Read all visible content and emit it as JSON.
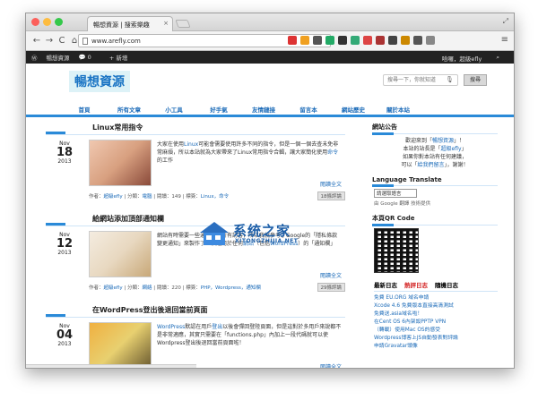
{
  "browser": {
    "tab_title": "暢想資源 | 搜索樂趣",
    "tab_close": "×",
    "url": "www.arefly.com",
    "nav": {
      "back": "←",
      "forward": "→",
      "reload": "C",
      "home": "⌂"
    },
    "star": "☆",
    "menu": "≡",
    "fullscreen": "⤢",
    "extension_colors": [
      "#d33",
      "#f0a020",
      "#555",
      "#2a6",
      "#333",
      "#3a7",
      "#d44",
      "#a33",
      "#444",
      "#c80",
      "#555",
      "#888"
    ]
  },
  "wpbar": {
    "site_name": "暢想資源",
    "comments": "0",
    "new": "+ 新增",
    "greeting": "哈囉，超級efly"
  },
  "site": {
    "logo": "暢想資源",
    "search_placeholder": "搜尋一下，你就知道",
    "search_button": "搜尋",
    "nav": [
      "首頁",
      "所有文章",
      "小工具",
      "好手氣",
      "友情鏈接",
      "留言本",
      "網站歷史",
      "關於本站"
    ]
  },
  "posts": [
    {
      "title": "Linux常用指令",
      "date": {
        "month": "Nov",
        "day": "18",
        "year": "2013"
      },
      "excerpt_a": "大家在使用",
      "excerpt_link": "Linux",
      "excerpt_b": "可能會需要使用許多不同的指令，但是一個一個去查未免非常麻煩，所以本站就為大家帶來了Linux常用指令合輯，讓大家簡化使用",
      "excerpt_link2": "命令",
      "excerpt_c": "的工作",
      "readmore": "閱讀全文",
      "meta_author": "作者：",
      "meta_author_name": "超級efly",
      "meta_cat": "分類：",
      "meta_cat_name": "電腦",
      "meta_views": "閱讀：149",
      "meta_tags": "標簽：",
      "meta_tag_list": "Linux，命令",
      "comments": "18條評論",
      "thumb_colors": [
        "#f0c8b0",
        "#8a4a3a",
        "#d8a080"
      ]
    },
    {
      "title": "給網站添加頂部通知欄",
      "date": {
        "month": "Nov",
        "day": "12",
        "year": "2013"
      },
      "excerpt_a": "網站有時需要一些通知來給所有訪客，所以我就參考了Google的「隱私條款變更通知」來製作了一個適用於任何",
      "excerpt_link": "網站",
      "excerpt_b": "（包括",
      "excerpt_link2": "WordPress",
      "excerpt_c": "）的「通知欄」",
      "readmore": "閱讀全文",
      "meta_author": "作者：",
      "meta_author_name": "超級efly",
      "meta_cat": "分類：",
      "meta_cat_name": "網絡",
      "meta_views": "閱讀：220",
      "meta_tags": "標簽：",
      "meta_tag_list": "PHP，Wordpress，通知欄",
      "comments": "29條評論",
      "thumb_colors": [
        "#f4ece0",
        "#c8a878",
        "#e8d8c0"
      ]
    },
    {
      "title": "在WordPress登出後退回當前頁面",
      "date": {
        "month": "Nov",
        "day": "04",
        "year": "2013"
      },
      "excerpt_a": "",
      "excerpt_link": "WordPress",
      "excerpt_b": "默認在用戶",
      "excerpt_link2": "登出",
      "excerpt_c": "以後會彈回登陸頁面，但是這對於多用戶來說都不是非常適應，其實只需要在「functions.php」內加上一段代碼就可以使Wordpress登出後退回當前頁面啦！",
      "readmore": "閱讀全文",
      "thumb_colors": [
        "#f0b040",
        "#6a5a30",
        "#e8d070"
      ]
    }
  ],
  "sidebar": {
    "notice_title": "網站公告",
    "notice_l1a": "歡迎來到「",
    "notice_l1_link": "暢想資源",
    "notice_l1b": "」！",
    "notice_l2a": "本站的站長是「",
    "notice_l2_link": "超級efly",
    "notice_l2b": "」",
    "notice_l3": "如果你對本站有任何建議，",
    "notice_l4a": "可以「",
    "notice_l4_link": "給我們留言",
    "notice_l4b": "」，謝謝！",
    "lang_title": "Language Translate",
    "lang_select": "請選取語言",
    "google_line": "由 Google 翻譯 技術提供",
    "qr_title": "本頁QR Code",
    "tabs": [
      "最新日志",
      "熱評日志",
      "隨機日志"
    ],
    "list": [
      "免費 EU.ORG 域名申請",
      "Xcode 4.6 免費版本直接高清測試",
      "免費送.asia域名啦！",
      "在Cent OS 6內架設PPTP VPN",
      "（轉載）使用Mac OS的感受",
      "Wordpress博客上JS自動發表對評論",
      "申請Gravatar頭像"
    ]
  },
  "watermark": {
    "text": "系统之家",
    "url": "XITONGZHIJIA.NET"
  }
}
